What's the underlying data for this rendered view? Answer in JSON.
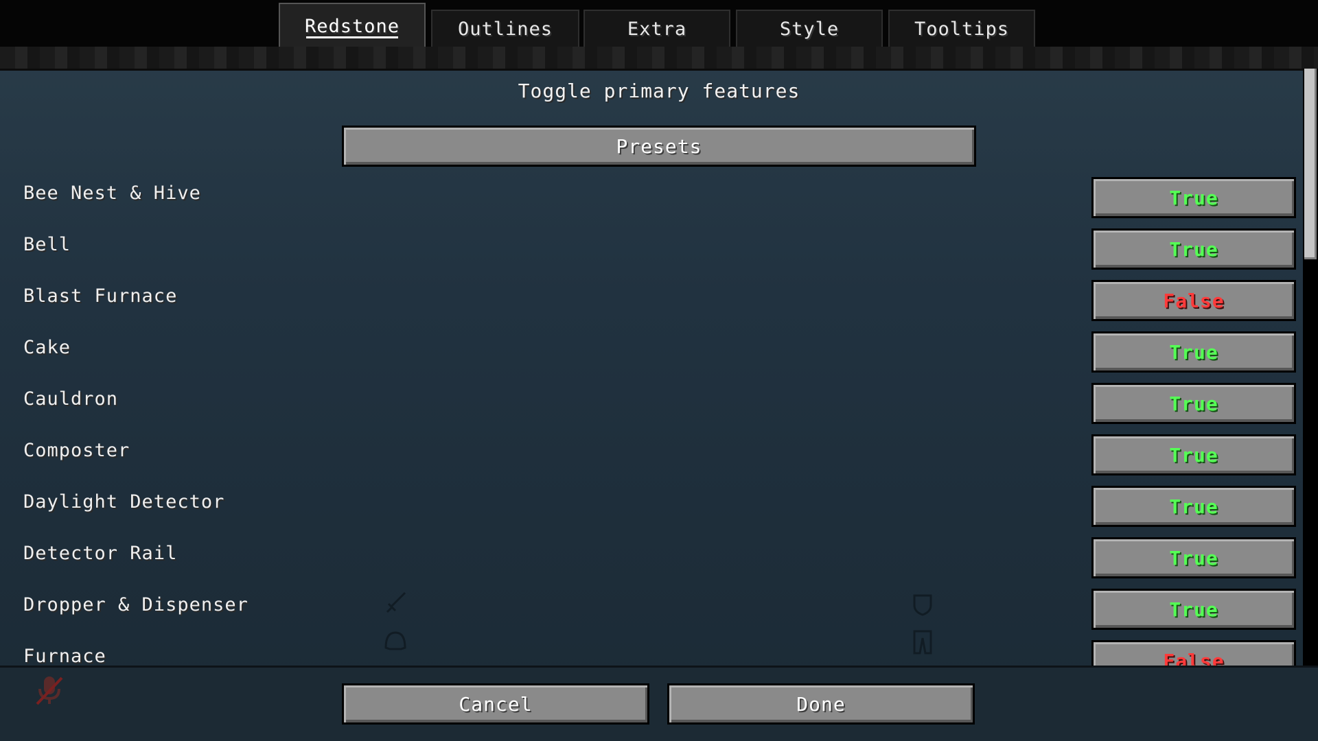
{
  "tabs": [
    {
      "label": "Redstone",
      "active": true
    },
    {
      "label": "Outlines",
      "active": false
    },
    {
      "label": "Extra",
      "active": false
    },
    {
      "label": "Style",
      "active": false
    },
    {
      "label": "Tooltips",
      "active": false
    }
  ],
  "header": {
    "title": "Toggle primary features"
  },
  "presets_label": "Presets",
  "options": [
    {
      "label": "Bee Nest & Hive",
      "value": "True"
    },
    {
      "label": "Bell",
      "value": "True"
    },
    {
      "label": "Blast Furnace",
      "value": "False"
    },
    {
      "label": "Cake",
      "value": "True"
    },
    {
      "label": "Cauldron",
      "value": "True"
    },
    {
      "label": "Composter",
      "value": "True"
    },
    {
      "label": "Daylight Detector",
      "value": "True"
    },
    {
      "label": "Detector Rail",
      "value": "True"
    },
    {
      "label": "Dropper & Dispenser",
      "value": "True"
    },
    {
      "label": "Furnace",
      "value": "False"
    }
  ],
  "footer": {
    "cancel_label": "Cancel",
    "done_label": "Done"
  },
  "icons": {
    "sword": "sword-icon",
    "helmet": "helmet-slot-icon",
    "shield": "shield-slot-icon",
    "leggings": "leggings-slot-icon",
    "mute": "muted-microphone-icon"
  },
  "colors": {
    "true": "#55ff55",
    "false": "#ff3a3a",
    "button": "#8a8a8a",
    "background": "#213240"
  }
}
